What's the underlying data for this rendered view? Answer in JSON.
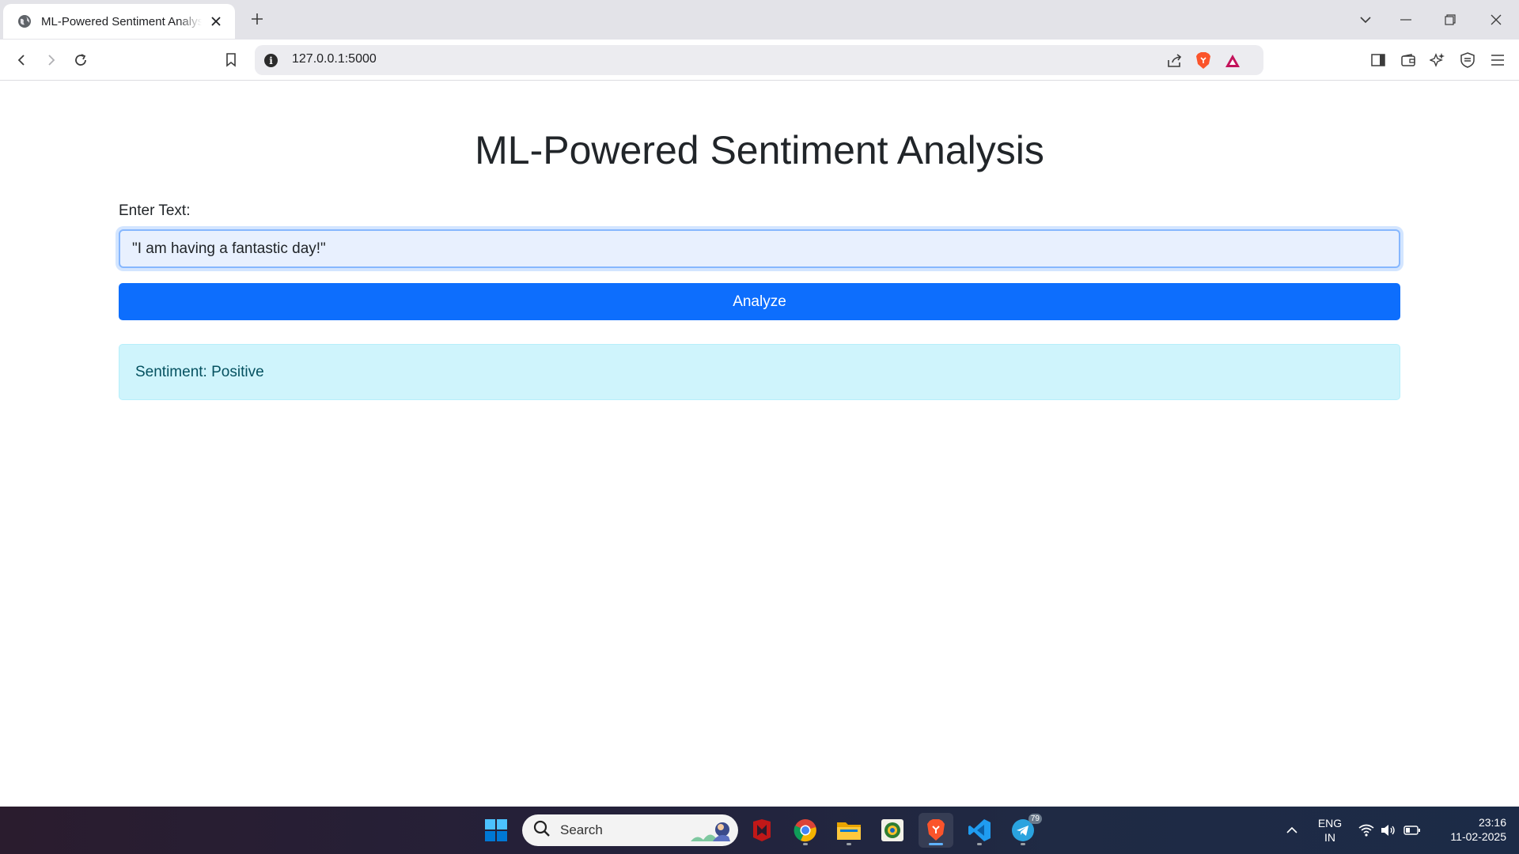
{
  "browser": {
    "tab": {
      "title": "ML-Powered Sentiment Analysis",
      "favicon": "globe-icon"
    },
    "address": {
      "url": "127.0.0.1:5000"
    },
    "colors": {
      "brave": "#fb542b",
      "rewards": "#c3135b"
    }
  },
  "page": {
    "heading": "ML-Powered Sentiment Analysis",
    "input_label": "Enter Text:",
    "input_value": "\"I am having a fantastic day!\"",
    "button_label": "Analyze",
    "result_text": "Sentiment: Positive",
    "colors": {
      "primary": "#0d6efd",
      "alert_bg": "#cff4fc",
      "alert_text": "#055160"
    }
  },
  "taskbar": {
    "search_placeholder": "Search",
    "apps": [
      "mcafee-icon",
      "chrome-icon",
      "file-explorer-icon",
      "emblem-app-icon",
      "brave-icon",
      "vscode-icon",
      "telegram-icon"
    ],
    "telegram_badge": "79",
    "language": {
      "line1": "ENG",
      "line2": "IN"
    },
    "clock": {
      "time": "23:16",
      "date": "11-02-2025"
    }
  }
}
